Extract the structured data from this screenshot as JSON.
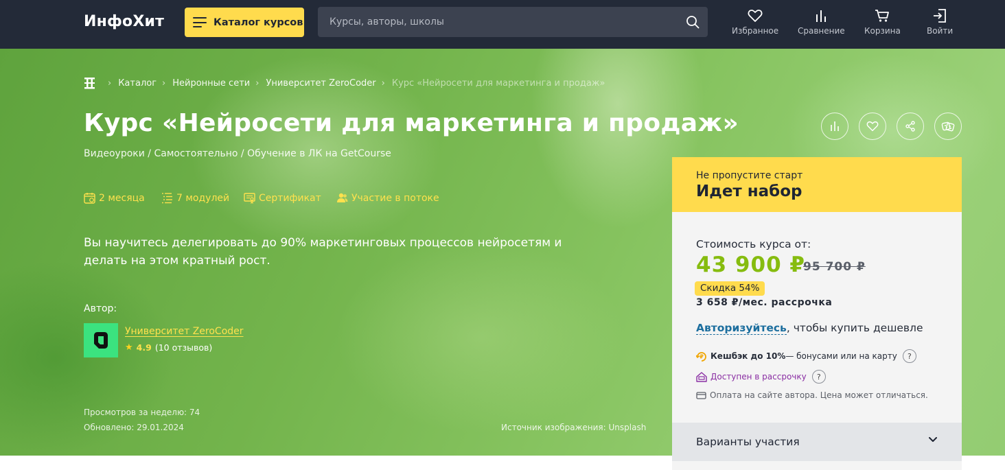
{
  "header": {
    "logo": "ИнфоХит",
    "catalog_label": "Каталог курсов",
    "search_placeholder": "Курсы, авторы, школы",
    "nav": [
      {
        "label": "Избранное",
        "icon": "heart-icon"
      },
      {
        "label": "Сравнение",
        "icon": "compare-icon"
      },
      {
        "label": "Корзина",
        "icon": "cart-icon"
      },
      {
        "label": "Войти",
        "icon": "login-icon"
      }
    ]
  },
  "breadcrumb": {
    "items": [
      "Каталог",
      "Нейронные сети",
      "Университет ZeroCoder"
    ],
    "current": "Курс «Нейросети для маркетинга и продаж»"
  },
  "course": {
    "title": "Курс «Нейросети для маркетинга и продаж»",
    "subtitle": "Видеоуроки / Самостоятельно / Обучение в ЛК на GetCourse",
    "features": [
      {
        "label": "2 месяца",
        "icon": "calendar-icon"
      },
      {
        "label": "7 модулей",
        "icon": "modules-icon"
      },
      {
        "label": "Сертификат",
        "icon": "certificate-icon"
      },
      {
        "label": "Участие в потоке",
        "icon": "group-icon"
      }
    ],
    "tagline": "Вы научитесь делегировать до 90% маркетинговых процессов нейросетям и делать на этом кратный рост.",
    "author_label": "Автор:",
    "author_name": "Университет ZeroCoder",
    "rating": "4.9",
    "reviews": "(10 отзывов)",
    "views": "Просмотров за неделю: 74",
    "updated": "Обновлено: 29.01.2024",
    "image_source": "Источник изображения: Unsplash"
  },
  "actions": [
    "compare-icon",
    "heart-icon",
    "share-icon",
    "dice-icon"
  ],
  "card": {
    "top_small": "Не пропустите старт",
    "top_big": "Идет набор",
    "cost_label": "Стоимость курса от:",
    "price": "43 900 ₽",
    "old_price": "95 700 ₽",
    "discount": "Скидка 54%",
    "installment": "3 658 ₽/мес. рассрочка",
    "auth_link": "Авторизуйтесь",
    "auth_rest": ", чтобы купить дешевле",
    "cashback_bold": "Кешбэк до 10%",
    "cashback_rest": " — бонусами или на карту",
    "installment_available": "Доступен в рассрочку",
    "payment_note": "Оплата на сайте автора. Цена может отличаться.",
    "question_mark": "?",
    "variants": "Варианты участия"
  },
  "colors": {
    "header_bg": "#232a38",
    "accent_yellow": "#ffdb4d",
    "price_green": "#86bc0f",
    "link_blue": "#1c6e9e",
    "installment_purple": "#8a2ea3"
  }
}
